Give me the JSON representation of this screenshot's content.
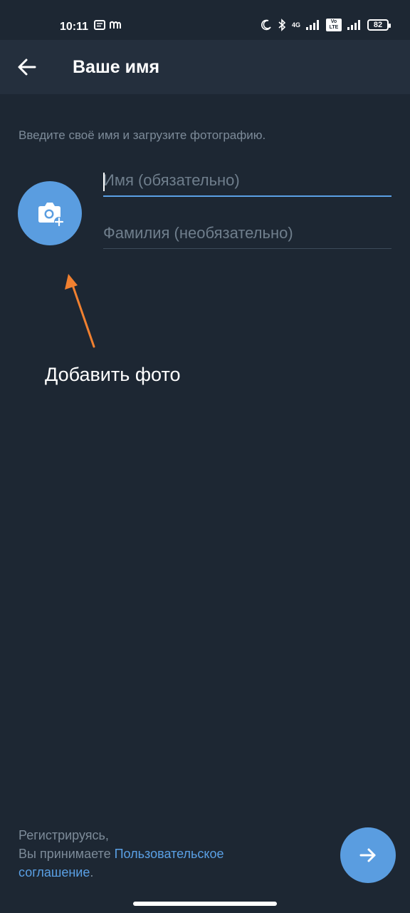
{
  "status_bar": {
    "time": "10:11",
    "network_label": "4G",
    "volte_label": "Vo LTE",
    "battery": "82"
  },
  "header": {
    "title": "Ваше имя"
  },
  "main": {
    "subtitle": "Введите своё имя и загрузите фотографию.",
    "first_name": {
      "placeholder": "Имя (обязательно)",
      "value": ""
    },
    "last_name": {
      "placeholder": "Фамилия (необязательно)",
      "value": ""
    },
    "annotation": "Добавить фото"
  },
  "footer": {
    "line1": "Регистрируясь,",
    "line2_prefix": "Вы принимаете ",
    "link_part1": "Пользовательское",
    "link_part2": "соглашение",
    "suffix": "."
  },
  "icons": {
    "back": "arrow-left-icon",
    "avatar": "camera-add-icon",
    "next": "arrow-right-icon"
  },
  "colors": {
    "background": "#1d2733",
    "app_bar": "#242f3d",
    "accent": "#5a9de0",
    "annotation_arrow": "#f08030"
  }
}
